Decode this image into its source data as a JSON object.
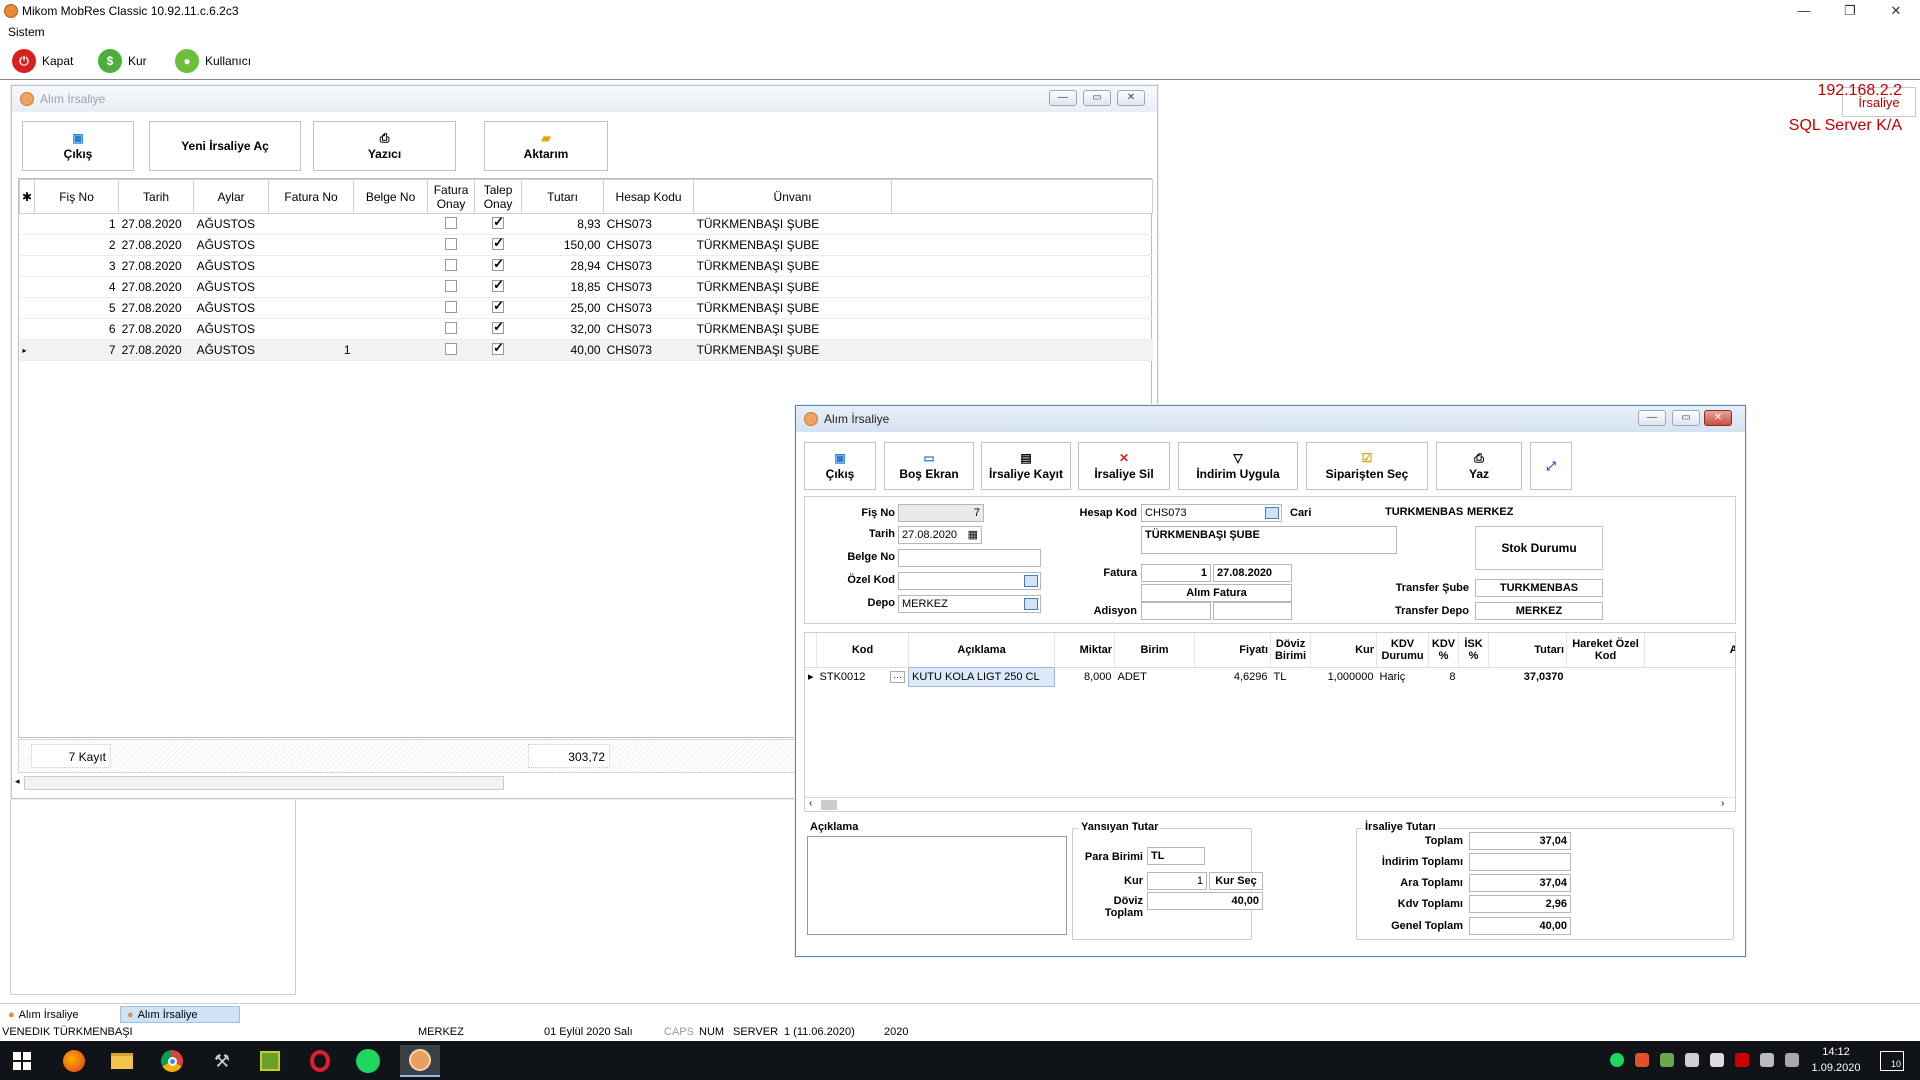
{
  "window": {
    "title": "Mikom MobRes Classic 10.92.11.c.6.2c3",
    "min": "—",
    "max": "❐",
    "close": "✕"
  },
  "menu": {
    "system": "Sistem"
  },
  "toolbar": {
    "close_label": "Kapat",
    "rate_label": "Kur",
    "user_label": "Kullanıcı",
    "irsaliye_label": "İrsaliye"
  },
  "server_info": {
    "ip": "192.168.2.2",
    "db": "SQL Server K/A"
  },
  "list_window": {
    "title": "Alım İrsaliye",
    "buttons": {
      "exit": "Çıkış",
      "new": "Yeni İrsaliye Aç",
      "printer": "Yazıcı",
      "transfer": "Aktarım"
    },
    "columns": [
      "Fiş No",
      "Tarih",
      "Aylar",
      "Fatura No",
      "Belge No",
      "Fatura Onay",
      "Talep Onay",
      "Tutarı",
      "Hesap Kodu",
      "Ünvanı"
    ],
    "rows": [
      {
        "fis": "1",
        "tarih": "27.08.2020",
        "ay": "AĞUSTOS",
        "fatura": "",
        "belge": "",
        "fonay": false,
        "tonay": true,
        "tutar": "8,93",
        "hesap": "CHS073",
        "unvan": "TÜRKMENBAŞI ŞUBE"
      },
      {
        "fis": "2",
        "tarih": "27.08.2020",
        "ay": "AĞUSTOS",
        "fatura": "",
        "belge": "",
        "fonay": false,
        "tonay": true,
        "tutar": "150,00",
        "hesap": "CHS073",
        "unvan": "TÜRKMENBAŞI ŞUBE"
      },
      {
        "fis": "3",
        "tarih": "27.08.2020",
        "ay": "AĞUSTOS",
        "fatura": "",
        "belge": "",
        "fonay": false,
        "tonay": true,
        "tutar": "28,94",
        "hesap": "CHS073",
        "unvan": "TÜRKMENBAŞI ŞUBE"
      },
      {
        "fis": "4",
        "tarih": "27.08.2020",
        "ay": "AĞUSTOS",
        "fatura": "",
        "belge": "",
        "fonay": false,
        "tonay": true,
        "tutar": "18,85",
        "hesap": "CHS073",
        "unvan": "TÜRKMENBAŞI ŞUBE"
      },
      {
        "fis": "5",
        "tarih": "27.08.2020",
        "ay": "AĞUSTOS",
        "fatura": "",
        "belge": "",
        "fonay": false,
        "tonay": true,
        "tutar": "25,00",
        "hesap": "CHS073",
        "unvan": "TÜRKMENBAŞI ŞUBE"
      },
      {
        "fis": "6",
        "tarih": "27.08.2020",
        "ay": "AĞUSTOS",
        "fatura": "",
        "belge": "",
        "fonay": false,
        "tonay": true,
        "tutar": "32,00",
        "hesap": "CHS073",
        "unvan": "TÜRKMENBAŞI ŞUBE"
      },
      {
        "fis": "7",
        "tarih": "27.08.2020",
        "ay": "AĞUSTOS",
        "fatura": "1",
        "belge": "",
        "fonay": false,
        "tonay": true,
        "tutar": "40,00",
        "hesap": "CHS073",
        "unvan": "TÜRKMENBAŞI ŞUBE"
      }
    ],
    "footer": {
      "count": "7 Kayıt",
      "total": "303,72"
    }
  },
  "detail_window": {
    "title": "Alım İrsaliye",
    "buttons": {
      "exit": "Çıkış",
      "blank": "Boş Ekran",
      "save": "İrsaliye Kayıt",
      "delete": "İrsaliye Sil",
      "discount": "İndirim Uygula",
      "from_order": "Siparişten Seç",
      "print": "Yaz"
    },
    "form": {
      "fis_no_label": "Fiş No",
      "fis_no": "7",
      "tarih_label": "Tarih",
      "tarih": "27.08.2020",
      "belge_no_label": "Belge No",
      "belge_no": "",
      "ozel_kod_label": "Özel Kod",
      "ozel_kod": "",
      "depo_label": "Depo",
      "depo": "MERKEZ",
      "hesap_kod_label": "Hesap Kod",
      "hesap_kod": "CHS073",
      "cari_label": "Cari",
      "cari_kod": "TURKMENBAS",
      "cari_merkez": "MERKEZ",
      "unvan": "TÜRKMENBAŞI ŞUBE",
      "fatura_label": "Fatura",
      "fatura_no": "1",
      "fatura_tarih": "27.08.2020",
      "alim_fatura": "Alım Fatura",
      "adisyon_label": "Adisyon",
      "stok_durumu": "Stok Durumu",
      "transfer_sube_label": "Transfer Şube",
      "transfer_sube": "TURKMENBAS",
      "transfer_depo_label": "Transfer Depo",
      "transfer_depo": "MERKEZ"
    },
    "columns": [
      "Kod",
      "Açıklama",
      "Miktar",
      "Birim",
      "Fiyatı",
      "Döviz Birimi",
      "Kur",
      "KDV Durumu",
      "KDV %",
      "İSK %",
      "Tutarı",
      "Hareket Özel Kod",
      "Açıkla"
    ],
    "line": {
      "kod": "STK0012",
      "aciklama": "KUTU KOLA LIGT 250 CL",
      "miktar": "8,000",
      "birim": "ADET",
      "fiyat": "4,6296",
      "doviz": "TL",
      "kur": "1,000000",
      "kdv_durum": "Hariç",
      "kdv": "8",
      "isk": "",
      "tutar": "37,0370",
      "ozel": ""
    },
    "aciklama_label": "Açıklama",
    "yansiyan": {
      "title": "Yansıyan Tutar",
      "para_label": "Para Birimi",
      "para": "TL",
      "kur_label": "Kur",
      "kur": "1",
      "kur_sec": "Kur Seç",
      "doviz_label": "Döviz Toplam",
      "doviz": "40,00"
    },
    "totals": {
      "title": "İrsaliye Tutarı",
      "toplam_label": "Toplam",
      "toplam": "37,04",
      "indirim_label": "İndirim Toplamı",
      "indirim": "",
      "ara_label": "Ara Toplamı",
      "ara": "37,04",
      "kdv_label": "Kdv Toplamı",
      "kdv": "2,96",
      "genel_label": "Genel Toplam",
      "genel": "40,00"
    }
  },
  "mdi_tabs": [
    "Alım İrsaliye",
    "Alım İrsaliye"
  ],
  "status": {
    "user": "VENEDIK TÜRKMENBAŞI",
    "branch": "MERKEZ",
    "date": "01 Eylül 2020 Salı",
    "caps": "CAPS",
    "num": "NUM",
    "server": "SERVER",
    "period": "1 (11.06.2020)",
    "year": "2020"
  },
  "taskbar": {
    "time": "14:12",
    "date": "1.09.2020",
    "notif": "10"
  }
}
